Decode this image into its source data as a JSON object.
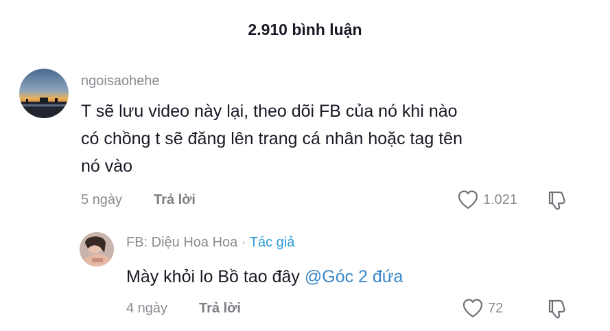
{
  "header": {
    "title": "2.910 bình luận"
  },
  "comments": [
    {
      "username": "ngoisaohehe",
      "text_lines": [
        "T sẽ lưu video này lại, theo dõi FB của nó khi nào",
        "có chồng t sẽ đăng lên trang cá nhân hoặc tag tên",
        "nó vào"
      ],
      "time": "5 ngày",
      "reply_label": "Trả lời",
      "likes": "1.021",
      "avatar_icon": "sunset-photo-avatar",
      "like_icon": "heart-icon",
      "dislike_icon": "thumbs-down-icon"
    }
  ],
  "reply": {
    "username": "FB: Diệu Hoa Hoa",
    "separator": "·",
    "author_tag": "Tác giả",
    "text": "Mày khỏi lo Bồ tao đây",
    "mention": "@Góc 2 đứa",
    "time": "4 ngày",
    "reply_label": "Trả lời",
    "likes": "72",
    "avatar_icon": "profile-photo-avatar",
    "like_icon": "heart-icon",
    "dislike_icon": "thumbs-down-icon"
  },
  "colors": {
    "text": "#161823",
    "muted": "#8a8b91",
    "author_tag": "#2b9ad6",
    "mention": "#3a86c8"
  }
}
